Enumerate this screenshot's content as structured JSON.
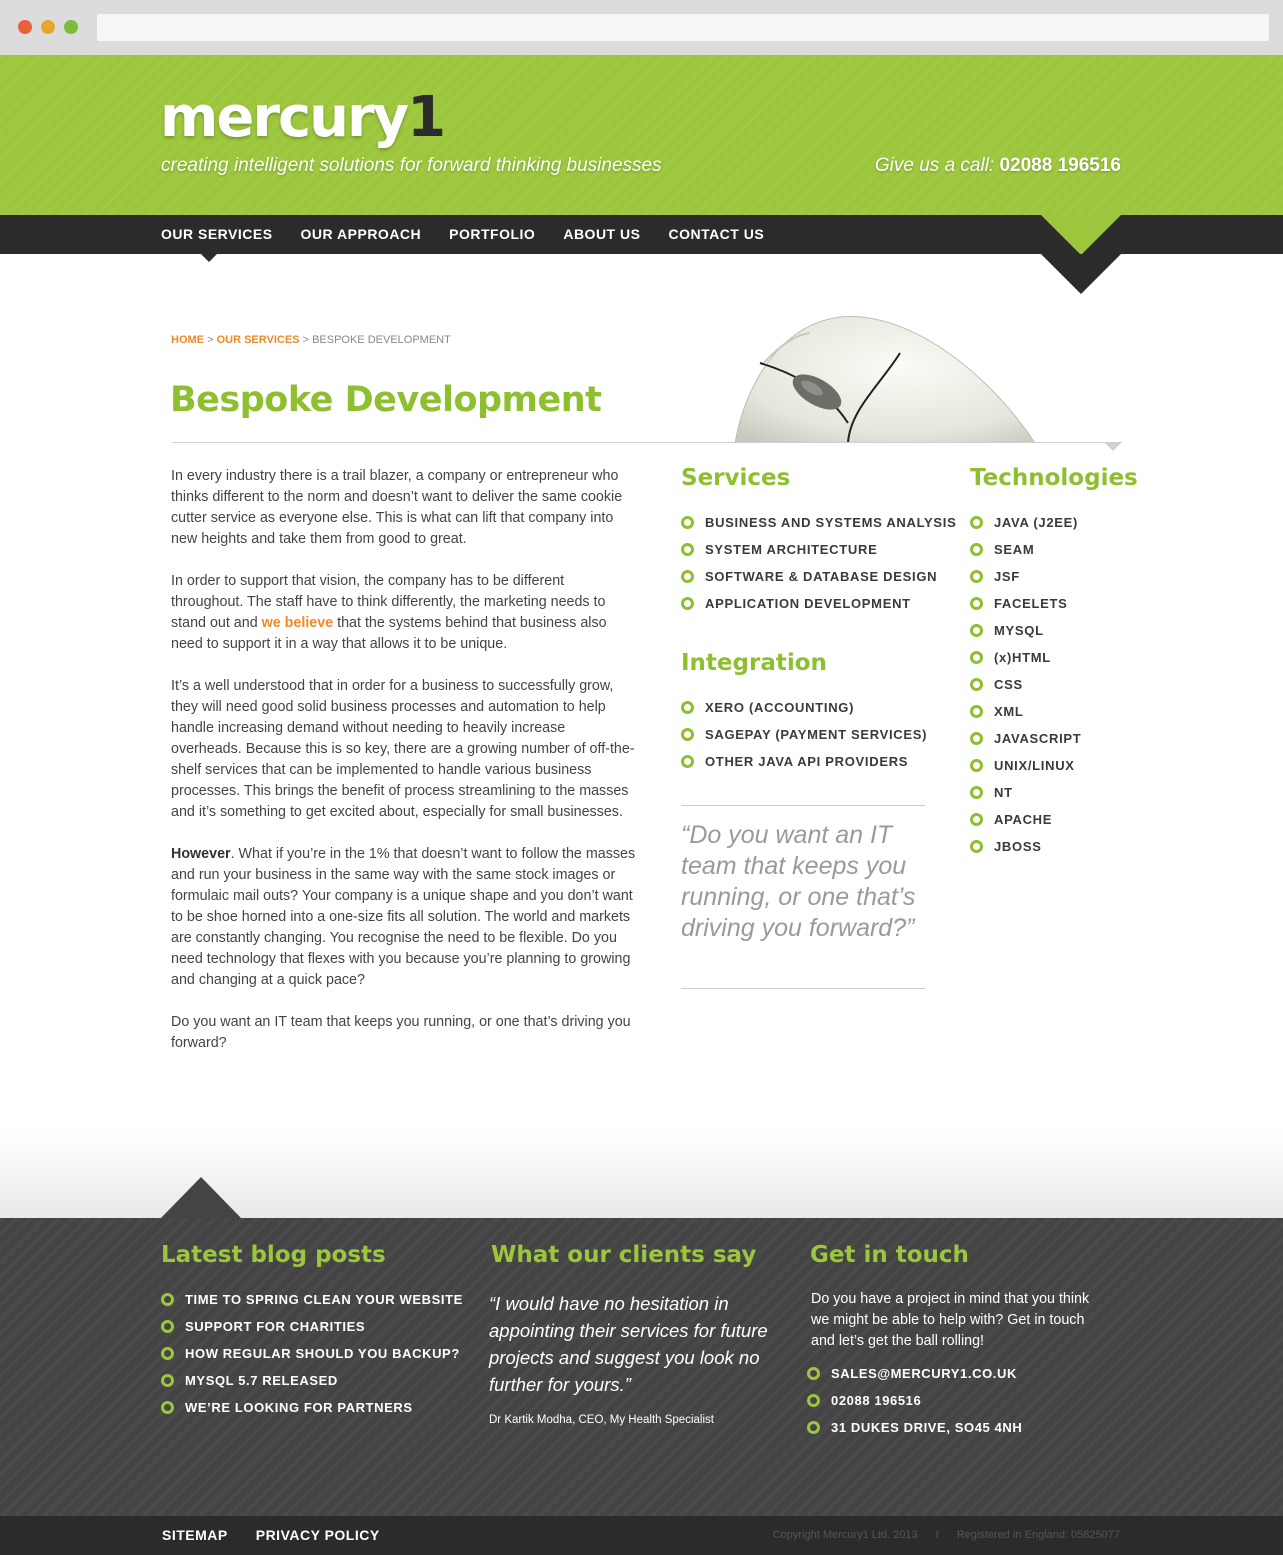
{
  "header": {
    "logo_text": "mercury",
    "logo_num": "1",
    "tagline": "creating intelligent solutions for forward thinking businesses",
    "call_label": "Give us a call:",
    "call_phone": "02088 196516"
  },
  "nav": {
    "items": [
      "OUR SERVICES",
      "OUR APPROACH",
      "PORTFOLIO",
      "ABOUT US",
      "CONTACT US"
    ]
  },
  "breadcrumb": {
    "home": "HOME",
    "services": "OUR SERVICES",
    "current": "BESPOKE DEVELOPMENT",
    "sep": ">"
  },
  "page": {
    "title": "Bespoke Development"
  },
  "body": {
    "p1": "In every industry there is a trail blazer, a company or entrepreneur who thinks different to the norm and doesn’t want to deliver the same cookie cutter service as everyone else. This is what can lift that company into new heights and take them from good to great.",
    "p2_a": "In order to support that vision, the company has to be different throughout. The staff have to think differently, the marketing needs to stand out and ",
    "p2_link": "we believe",
    "p2_b": " that the systems behind that business also need to support it in a way that allows it to be unique.",
    "p3": "It’s a well understood that in order for a business to successfully grow, they will need good solid business processes and automation to help handle increasing demand without needing to heavily increase overheads. Because this is so key, there are a growing number of off-the-shelf services that can be implemented to handle various business processes. This brings the benefit of process streamlining to the masses and it’s something to get excited about, especially for small businesses.",
    "p4_strong": "However",
    "p4": ". What if you’re in the 1% that doesn’t want to follow the masses and run your business in the same way with the same stock images or formulaic mail outs? Your company is a unique shape and you don’t want to be shoe horned into a one-size fits all solution. The world and markets are constantly changing. You recognise the need to be flexible. Do you need technology that flexes with you because you’re planning to growing and changing at a quick pace?",
    "p5": "Do you want an IT team that keeps you running, or one that’s driving you forward?"
  },
  "services": {
    "heading": "Services",
    "items": [
      "BUSINESS AND SYSTEMS ANALYSIS",
      "SYSTEM ARCHITECTURE",
      "SOFTWARE & DATABASE DESIGN",
      "APPLICATION DEVELOPMENT"
    ]
  },
  "integration": {
    "heading": "Integration",
    "items": [
      "XERO (ACCOUNTING)",
      "SAGEPAY (PAYMENT SERVICES)",
      "OTHER JAVA API PROVIDERS"
    ]
  },
  "pull_quote": "“Do you want an IT team that keeps you running, or one that’s driving you forward?”",
  "technologies": {
    "heading": "Technologies",
    "items": [
      "JAVA (J2EE)",
      "SEAM",
      "JSF",
      "FACELETS",
      "MYSQL",
      "(x)HTML",
      "CSS",
      "XML",
      "JAVASCRIPT",
      "UNIX/LINUX",
      "NT",
      "APACHE",
      "JBOSS"
    ]
  },
  "footer": {
    "blog_heading": "Latest blog posts",
    "blog_items": [
      "TIME TO SPRING CLEAN YOUR WEBSITE",
      "SUPPORT FOR CHARITIES",
      "HOW REGULAR SHOULD YOU BACKUP?",
      "MYSQL 5.7 RELEASED",
      "WE’RE LOOKING FOR PARTNERS"
    ],
    "clients_heading": "What our clients say",
    "testimonial": "“I would have no hesitation in appointing their services for future projects and suggest you look no further for yours.”",
    "testimonial_author": "Dr Kartik Modha, CEO, My Health Specialist",
    "contact_heading": "Get in touch",
    "contact_intro": "Do you have a project in mind that you think we might be able to help with? Get in touch and let’s get the ball rolling!",
    "contact_items": [
      "SALES@MERCURY1.CO.UK",
      "02088 196516",
      "31 DUKES DRIVE, SO45 4NH"
    ]
  },
  "bottom": {
    "links": [
      "SITEMAP",
      "PRIVACY POLICY"
    ],
    "copyright": "Copyright Mercury1 Ltd. 2013",
    "separator": "I",
    "registered": "Registered in England: 05825077"
  },
  "colors": {
    "brand_green": "#9cc63b",
    "heading_green": "#8dbf2f",
    "accent_orange": "#f08a24",
    "dark": "#2b2b2b",
    "footer_bg": "#444444"
  }
}
